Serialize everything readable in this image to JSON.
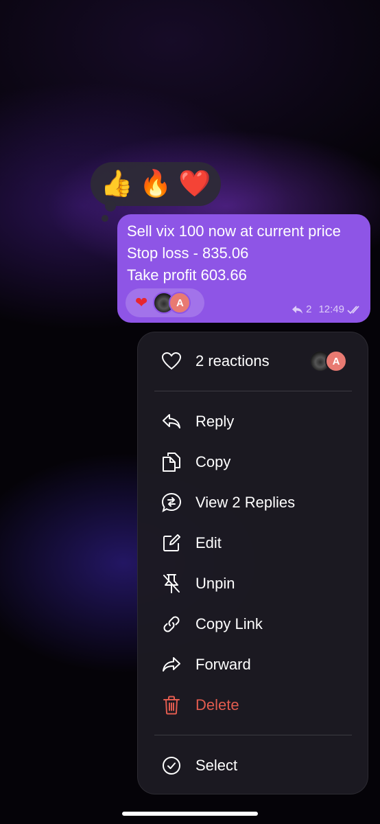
{
  "reaction_picker": {
    "emojis": [
      {
        "char": "👍",
        "icon": "thumbs-up-icon"
      },
      {
        "char": "🔥",
        "icon": "fire-icon"
      },
      {
        "char": "❤️",
        "icon": "red-heart-icon"
      }
    ]
  },
  "message": {
    "lines": [
      "Sell vix 100 now at current price",
      "Stop loss - 835.06",
      "Take profit 603.66"
    ],
    "reaction": {
      "emoji": "❤",
      "avatar_letter": "A"
    },
    "reply_count": "2",
    "time": "12:49",
    "bubble_color": "#8e55e6"
  },
  "context_menu": {
    "reactions": {
      "label": "2 reactions",
      "avatar_letter": "A"
    },
    "items": [
      {
        "label": "Reply",
        "icon": "reply-icon"
      },
      {
        "label": "Copy",
        "icon": "copy-icon"
      },
      {
        "label": "View 2 Replies",
        "icon": "view-replies-icon"
      },
      {
        "label": "Edit",
        "icon": "edit-icon"
      },
      {
        "label": "Unpin",
        "icon": "unpin-icon"
      },
      {
        "label": "Copy Link",
        "icon": "link-icon"
      },
      {
        "label": "Forward",
        "icon": "forward-icon"
      },
      {
        "label": "Delete",
        "icon": "trash-icon"
      }
    ],
    "select": {
      "label": "Select",
      "icon": "checkmark-circle-icon"
    },
    "danger_color": "#e25c4f"
  }
}
